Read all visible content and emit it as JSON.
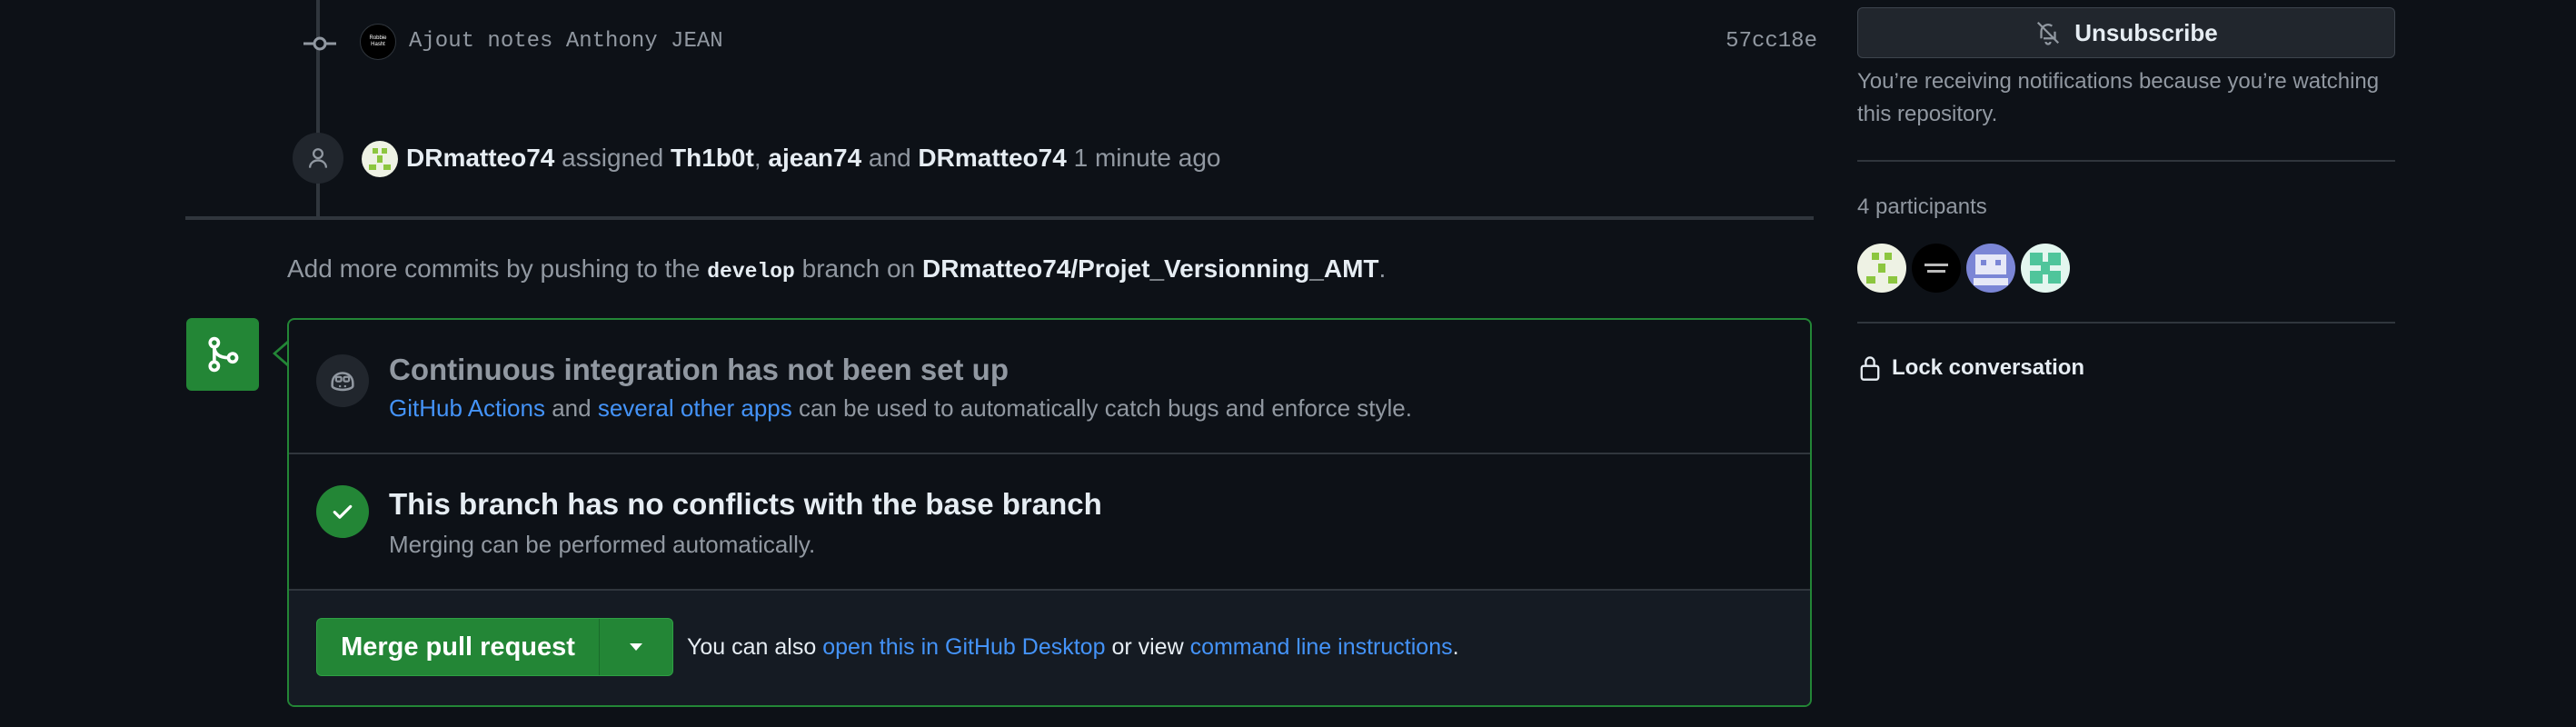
{
  "timeline": {
    "commit": {
      "avatar_text": "Robbie Hasht",
      "message": "Ajout notes Anthony JEAN",
      "sha": "57cc18e"
    },
    "assign_event": {
      "actor": "DRmatteo74",
      "verb": "assigned",
      "assignee1": "Th1b0t",
      "sep1": ",",
      "assignee2": "ajean74",
      "and_word": "and",
      "assignee3": "DRmatteo74",
      "time": "1 minute ago"
    },
    "push_hint": {
      "prefix": "Add more commits by pushing to the",
      "branch": "develop",
      "middle": "branch on",
      "repo": "DRmatteo74/Projet_Versionning_AMT",
      "suffix": "."
    }
  },
  "merge_box": {
    "ci": {
      "title": "Continuous integration has not been set up",
      "link1": "GitHub Actions",
      "and_word": "and",
      "link2": "several other apps",
      "rest": "can be used to automatically catch bugs and enforce style."
    },
    "conflicts": {
      "title": "This branch has no conflicts with the base branch",
      "subtitle": "Merging can be performed automatically."
    },
    "merge": {
      "button_label": "Merge pull request",
      "hint_prefix": "You can also",
      "hint_link1": "open this in GitHub Desktop",
      "hint_middle": "or view",
      "hint_link2": "command line instructions",
      "hint_suffix": "."
    }
  },
  "sidebar": {
    "unsubscribe_label": "Unsubscribe",
    "notification_text": "You’re receiving notifications because you’re watching this repository.",
    "participants_label": "4 participants",
    "lock_label": "Lock conversation"
  },
  "icons": {
    "commit": "git-commit-icon",
    "person": "person-icon",
    "merge": "git-merge-icon",
    "ci": "copilot-icon",
    "check": "check-icon",
    "caret": "triangle-down-icon",
    "bell_slash": "bell-slash-icon",
    "lock": "lock-icon"
  },
  "colors": {
    "background": "#0d1117",
    "accent_green": "#238636",
    "link_blue": "#4493f8",
    "muted_text": "#9198a1"
  }
}
